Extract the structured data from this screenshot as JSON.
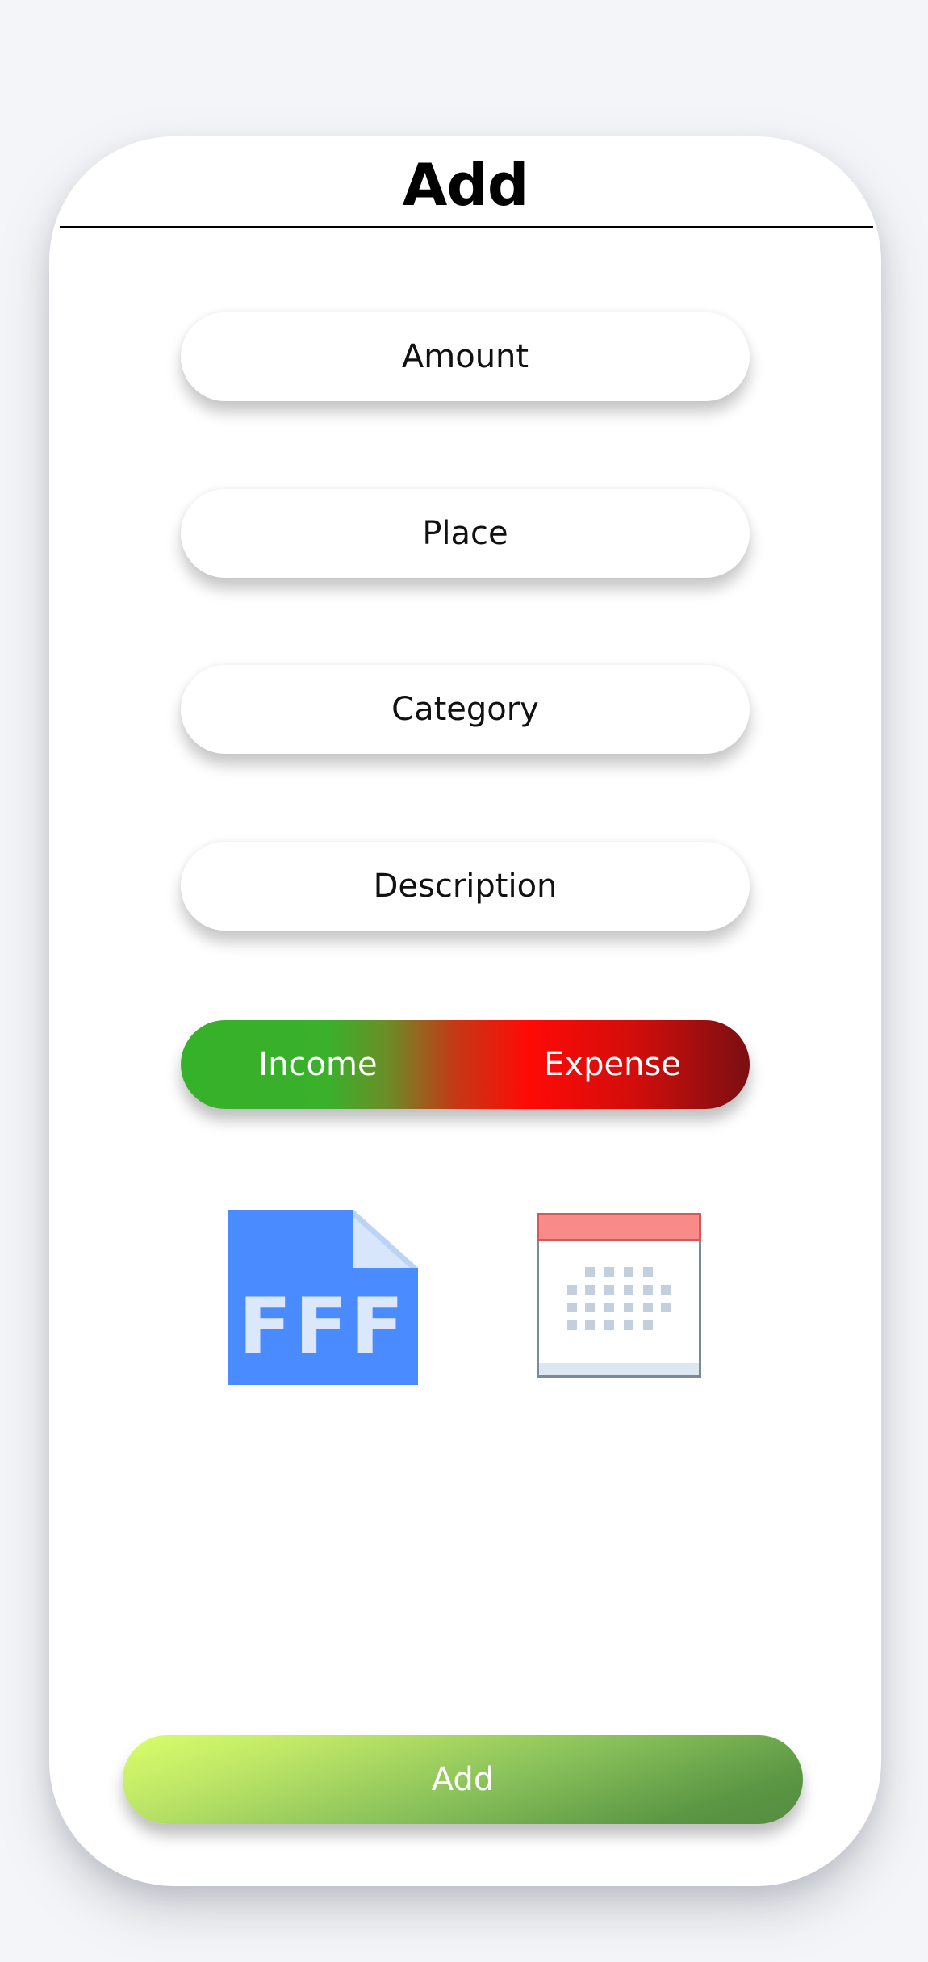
{
  "header": {
    "title": "Add"
  },
  "form": {
    "amount_placeholder": "Amount",
    "place_placeholder": "Place",
    "category_placeholder": "Category",
    "description_placeholder": "Description"
  },
  "type_toggle": {
    "income_label": "Income",
    "expense_label": "Expense"
  },
  "icons": {
    "file": {
      "name": "file-icon",
      "text": "FFF"
    },
    "calendar": {
      "name": "calendar-icon"
    }
  },
  "submit": {
    "label": "Add"
  },
  "colors": {
    "background": "#f4f5f8",
    "income_green": "#36b12a",
    "expense_red": "#ff0a06",
    "file_blue": "#4a8cff",
    "calendar_header": "#f88a8a",
    "add_gradient_start": "#d9ff6a",
    "add_gradient_end": "#548c40"
  }
}
